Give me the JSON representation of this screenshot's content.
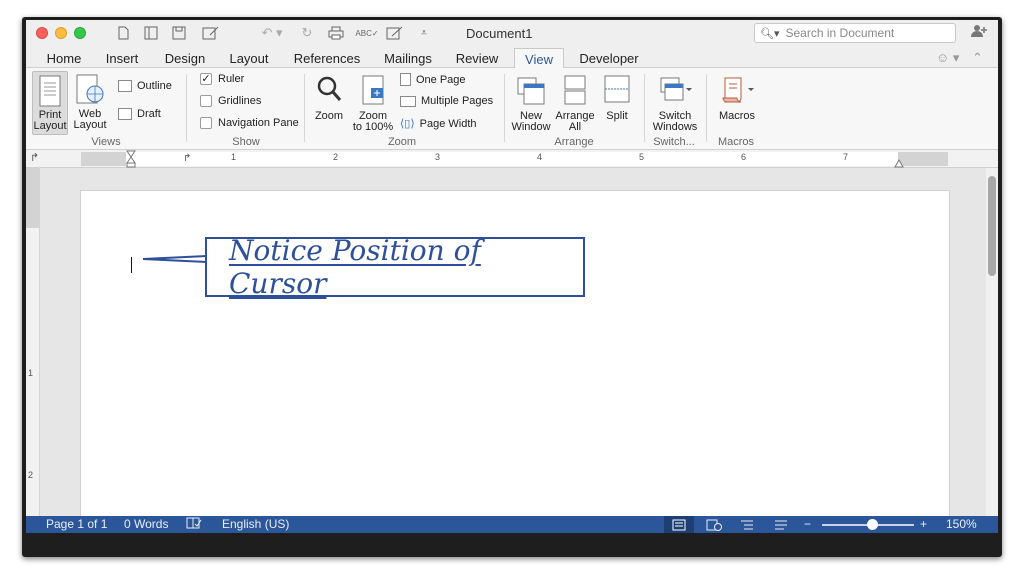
{
  "titlebar": {
    "document_title": "Document1",
    "search_placeholder": "Search in Document"
  },
  "tabs": [
    {
      "label": "Home"
    },
    {
      "label": "Insert"
    },
    {
      "label": "Design"
    },
    {
      "label": "Layout"
    },
    {
      "label": "References"
    },
    {
      "label": "Mailings"
    },
    {
      "label": "Review"
    },
    {
      "label": "View",
      "active": true
    },
    {
      "label": "Developer"
    }
  ],
  "ribbon": {
    "views": {
      "print_layout_1": "Print",
      "print_layout_2": "Layout",
      "web_layout_1": "Web",
      "web_layout_2": "Layout",
      "outline": "Outline",
      "draft": "Draft",
      "group": "Views"
    },
    "show": {
      "ruler": "Ruler",
      "ruler_checked": true,
      "gridlines": "Gridlines",
      "navigation_pane": "Navigation Pane",
      "group": "Show"
    },
    "zoom": {
      "zoom": "Zoom",
      "zoom100_1": "Zoom",
      "zoom100_2": "to 100%",
      "one_page": "One Page",
      "multiple_pages": "Multiple Pages",
      "page_width": "Page Width",
      "group": "Zoom"
    },
    "arrange": {
      "new_window_1": "New",
      "new_window_2": "Window",
      "arrange_all_1": "Arrange",
      "arrange_all_2": "All",
      "split": "Split",
      "group": "Arrange"
    },
    "switch": {
      "switch_1": "Switch",
      "switch_2": "Windows",
      "group": "Switch..."
    },
    "macros": {
      "macros": "Macros",
      "group": "Macros"
    }
  },
  "ruler": {
    "numbers": [
      "1",
      "2",
      "3",
      "4",
      "5",
      "6",
      "7"
    ],
    "vertical_numbers": [
      "1",
      "2"
    ]
  },
  "document": {
    "callout_text": "Notice Position of Cursor"
  },
  "statusbar": {
    "page": "Page 1 of 1",
    "words": "0 Words",
    "language": "English (US)",
    "zoom_minus": "−",
    "zoom_plus": "+",
    "zoom_level": "150%"
  },
  "colors": {
    "accent": "#2b579a",
    "callout": "#2e4f9a"
  }
}
